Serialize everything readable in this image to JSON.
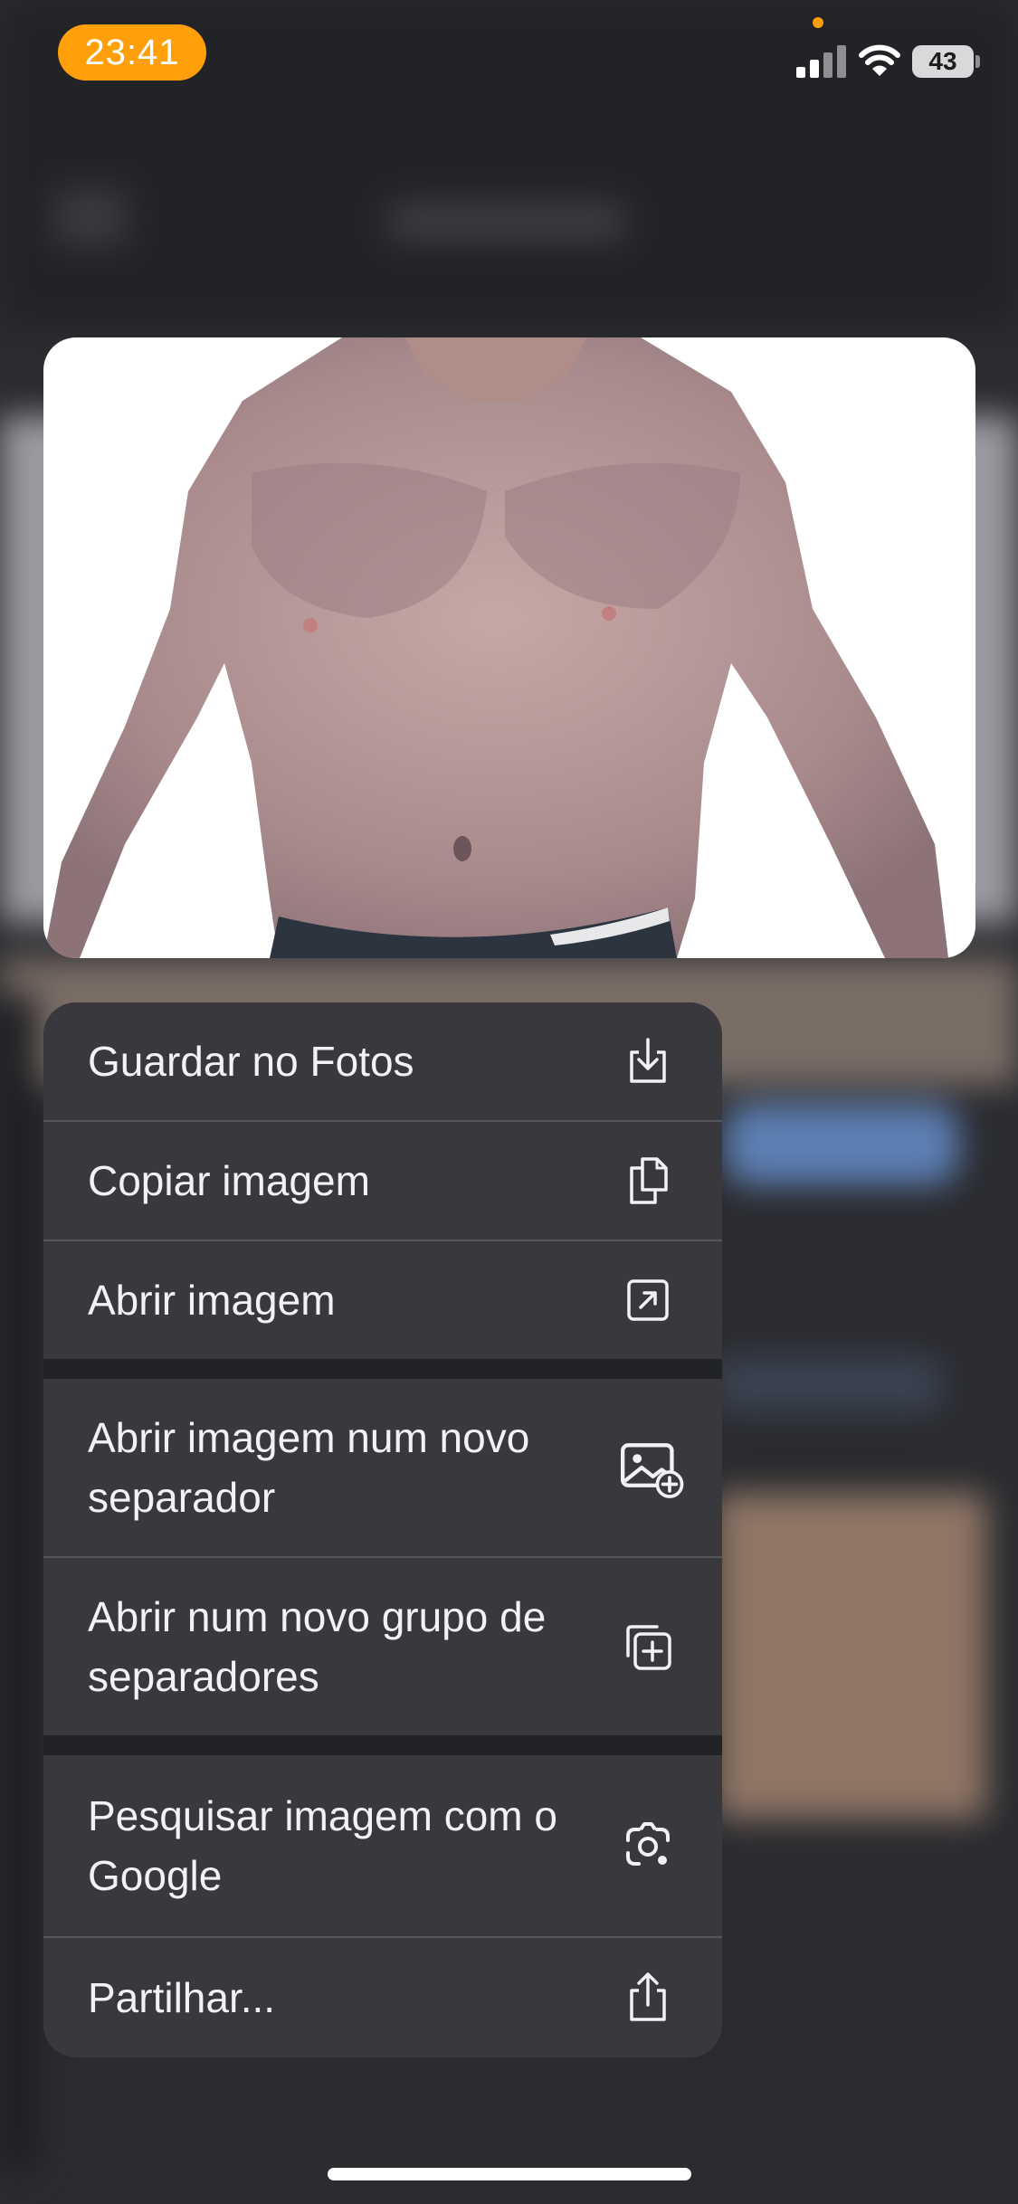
{
  "status_bar": {
    "time": "23:41",
    "battery": "43"
  },
  "preview": {
    "description_icon": "photo-preview"
  },
  "menu": {
    "items": [
      {
        "label": "Guardar no Fotos",
        "icon": "save-to-photos-icon"
      },
      {
        "label": "Copiar imagem",
        "icon": "copy-icon"
      },
      {
        "label": "Abrir imagem",
        "icon": "open-external-icon"
      },
      {
        "label": "Abrir imagem num novo separador",
        "icon": "image-add-icon"
      },
      {
        "label": "Abrir num novo grupo de separadores",
        "icon": "tab-group-add-icon"
      },
      {
        "label": "Pesquisar imagem com o Google",
        "icon": "google-lens-icon"
      },
      {
        "label": "Partilhar...",
        "icon": "share-icon"
      }
    ]
  },
  "colors": {
    "accent": "#ff9f0a",
    "menu_bg": "#3a3a3e",
    "text": "#f2f2f4"
  }
}
